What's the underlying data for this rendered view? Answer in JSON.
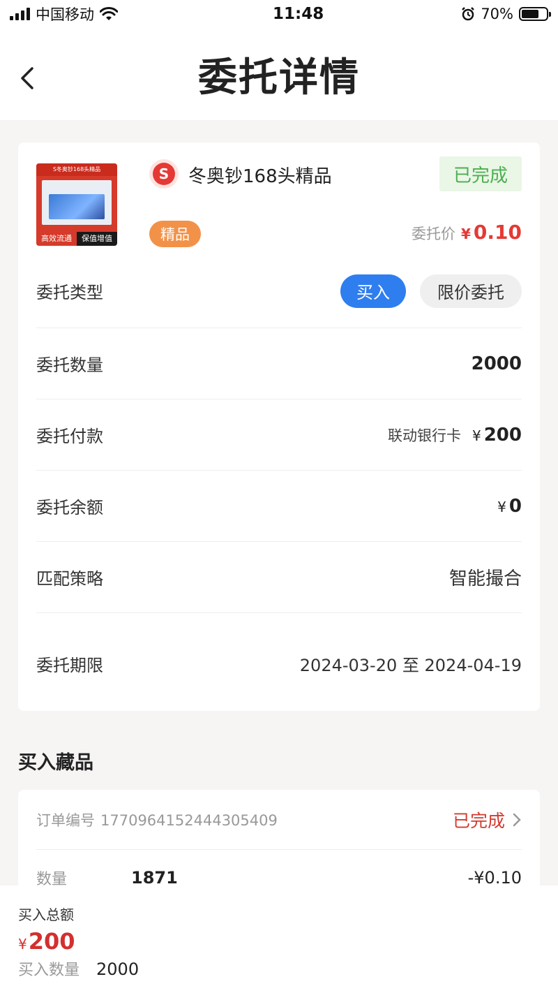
{
  "status_bar": {
    "carrier": "中国移动",
    "time": "11:48",
    "battery": "70%",
    "battery_level": 0.7
  },
  "header": {
    "title": "委托详情"
  },
  "product": {
    "thumb_top_text": "S冬奥钞168头精品",
    "thumb_badge_left": "高效流通",
    "thumb_badge_right": "保值增值",
    "logo_letter": "S",
    "name": "冬奥钞168头精品",
    "status": "已完成",
    "grade": "精品",
    "price_label": "委托价",
    "price_currency": "¥",
    "price": "0.10"
  },
  "details": {
    "type_label": "委托类型",
    "type_buy": "买入",
    "type_limit": "限价委托",
    "qty_label": "委托数量",
    "qty_value": "2000",
    "payment_label": "委托付款",
    "payment_method": "联动银行卡",
    "payment_currency": "¥",
    "payment_value": "200",
    "balance_label": "委托余额",
    "balance_currency": "¥",
    "balance_value": "0",
    "strategy_label": "匹配策略",
    "strategy_value": "智能撮合",
    "period_label": "委托期限",
    "period_value": "2024-03-20 至 2024-04-19"
  },
  "buy_section": {
    "title": "买入藏品",
    "order_label": "订单编号",
    "order_number": "1770964152444305409",
    "order_status": "已完成",
    "qty_label": "数量",
    "qty_value": "1871",
    "price_value": "-¥0.10"
  },
  "bottom": {
    "total_label": "买入总额",
    "total_currency": "¥",
    "total_value": "200",
    "qty_label": "买入数量",
    "qty_value": "2000"
  }
}
